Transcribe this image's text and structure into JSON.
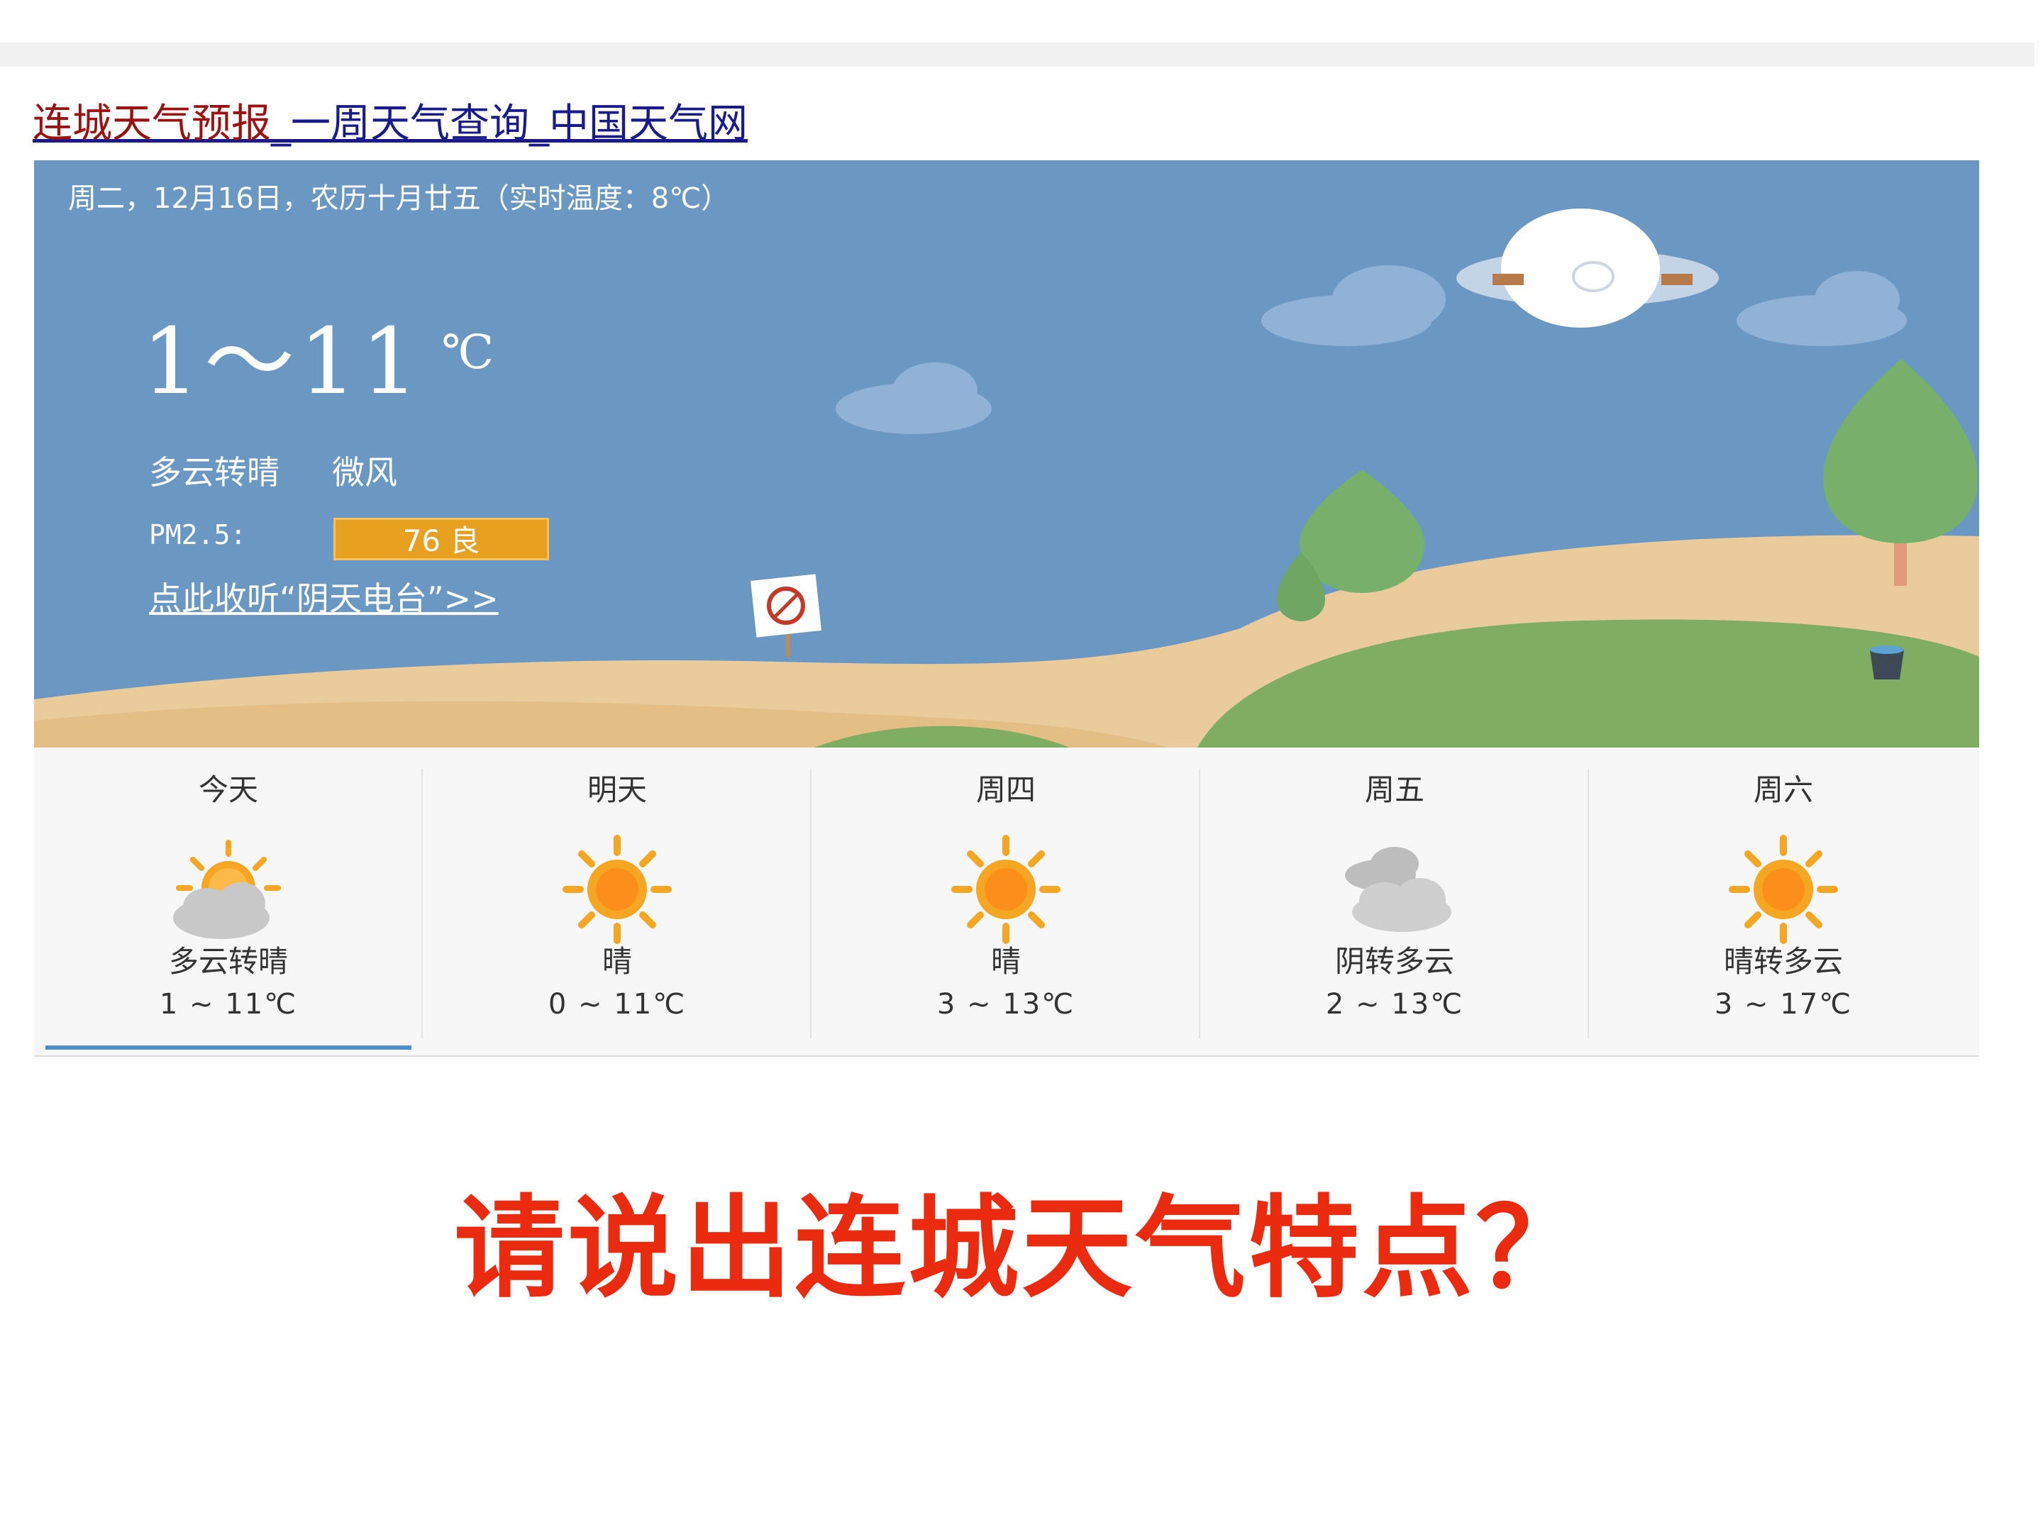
{
  "page": {
    "title_link_part1": "连城天气预报",
    "title_link_part2": "_一周天气查询_中国天气网"
  },
  "current": {
    "date_line": "周二，12月16日，农历十月廿五（实时温度：8℃）",
    "temp_range": "1～11",
    "temp_unit": "℃",
    "condition": "多云转晴",
    "wind": "微风",
    "pm_label": "PM2.5:",
    "pm_value": "76 良",
    "radio_link": "点此收听“阴天电台”>>"
  },
  "forecast": [
    {
      "day": "今天",
      "condition": "多云转晴",
      "temp": "1 ~ 11℃",
      "icon": "partly-cloudy-sun-icon",
      "active": true
    },
    {
      "day": "明天",
      "condition": "晴",
      "temp": "0 ~ 11℃",
      "icon": "sun-icon"
    },
    {
      "day": "周四",
      "condition": "晴",
      "temp": "3 ~ 13℃",
      "icon": "sun-icon"
    },
    {
      "day": "周五",
      "condition": "阴转多云",
      "temp": "2 ~ 13℃",
      "icon": "cloud-icon"
    },
    {
      "day": "周六",
      "condition": "晴转多云",
      "temp": "3 ~ 17℃",
      "icon": "sun-icon"
    }
  ],
  "question": "请说出连城天气特点？",
  "colors": {
    "sky": "#6b98c3",
    "pm_badge": "#e8a020",
    "question": "#ea2b0f",
    "sun": "#f5a623"
  }
}
